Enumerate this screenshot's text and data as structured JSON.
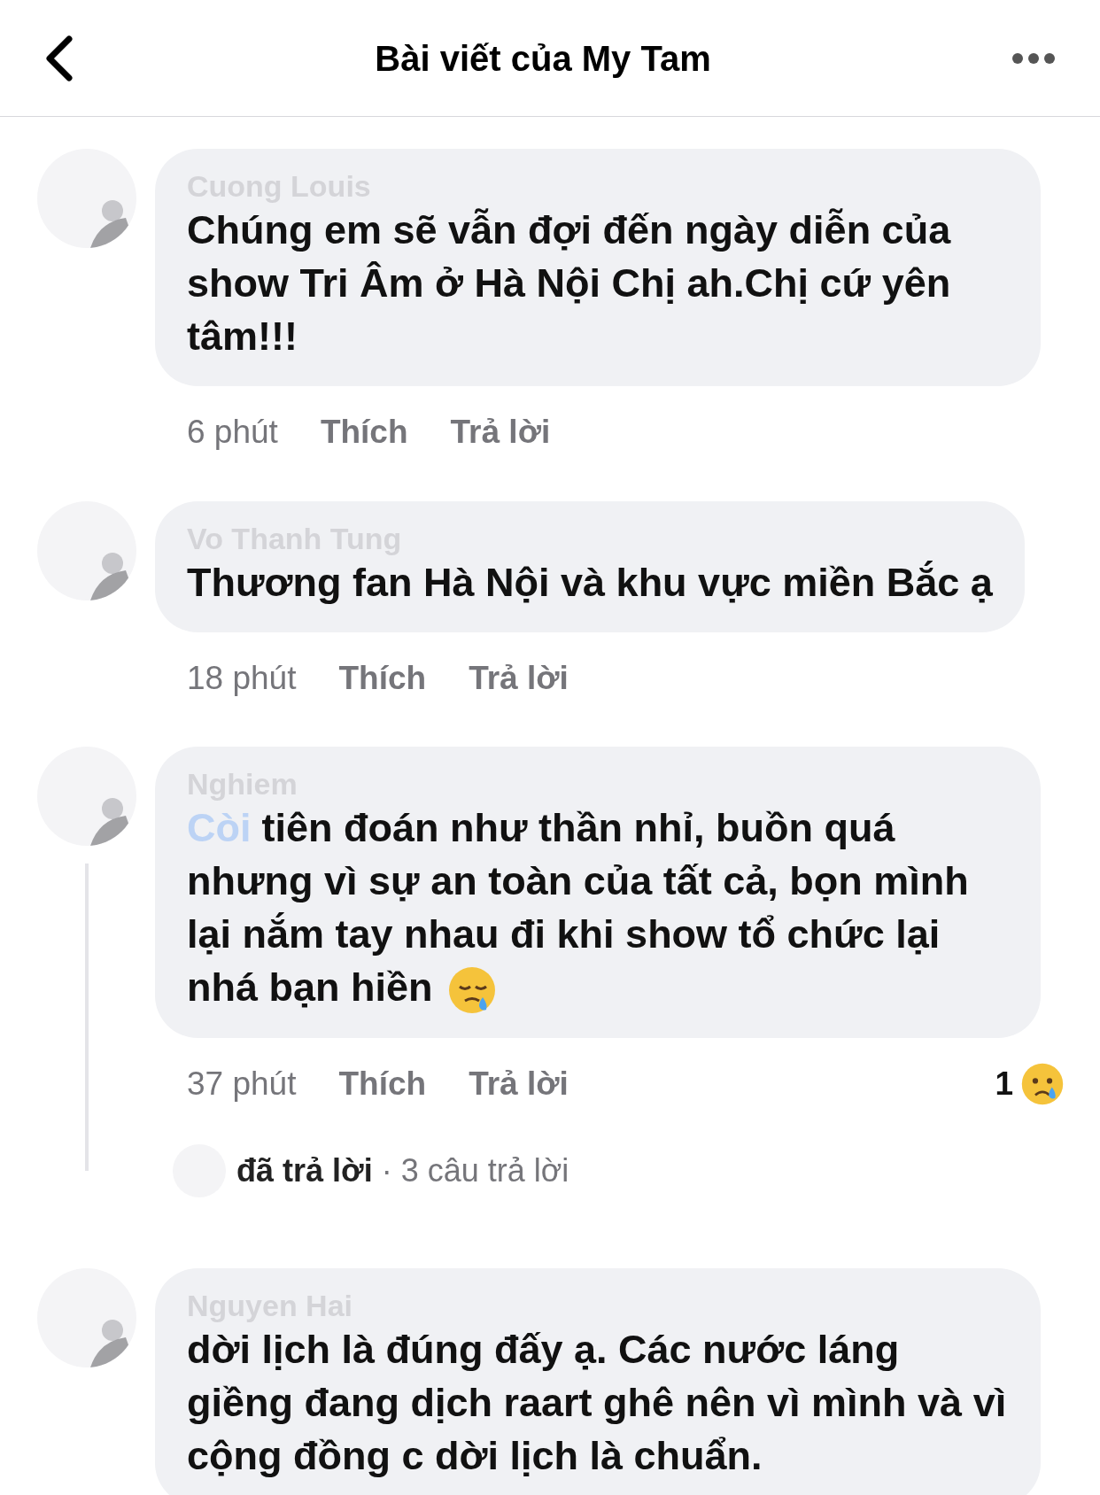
{
  "header": {
    "title": "Bài viết của My Tam"
  },
  "comments": [
    {
      "author": "Cuong Louis",
      "text": "Chúng em sẽ vẫn đợi đến ngày diễn của show Tri Âm ở Hà Nội Chị ah.Chị cứ yên tâm!!!",
      "time": "6 phút",
      "like": "Thích",
      "reply": "Trả lời"
    },
    {
      "author": "Vo Thanh Tung",
      "text": "Thương fan Hà Nội và khu vực miền Bắc ạ",
      "time": "18 phút",
      "like": "Thích",
      "reply": "Trả lời"
    },
    {
      "author": "Nghiem",
      "mention": "Còi",
      "text": "tiên đoán như thần nhỉ, buồn quá nhưng vì sự an toàn của tất cả, bọn mình lại nắm tay nhau đi khi show tổ chức lại nhá bạn hiền",
      "emoji": true,
      "time": "37 phút",
      "like": "Thích",
      "reply": "Trả lời",
      "reaction_count": "1",
      "replies": {
        "action": "đã trả lời",
        "count": "· 3 câu trả lời"
      }
    },
    {
      "author": "Nguyen Hai",
      "text": "dời lịch là đúng đấy ạ. Các nước láng giềng đang dịch raart ghê nên vì mình và vì cộng đồng c dời lịch là chuẩn."
    }
  ]
}
